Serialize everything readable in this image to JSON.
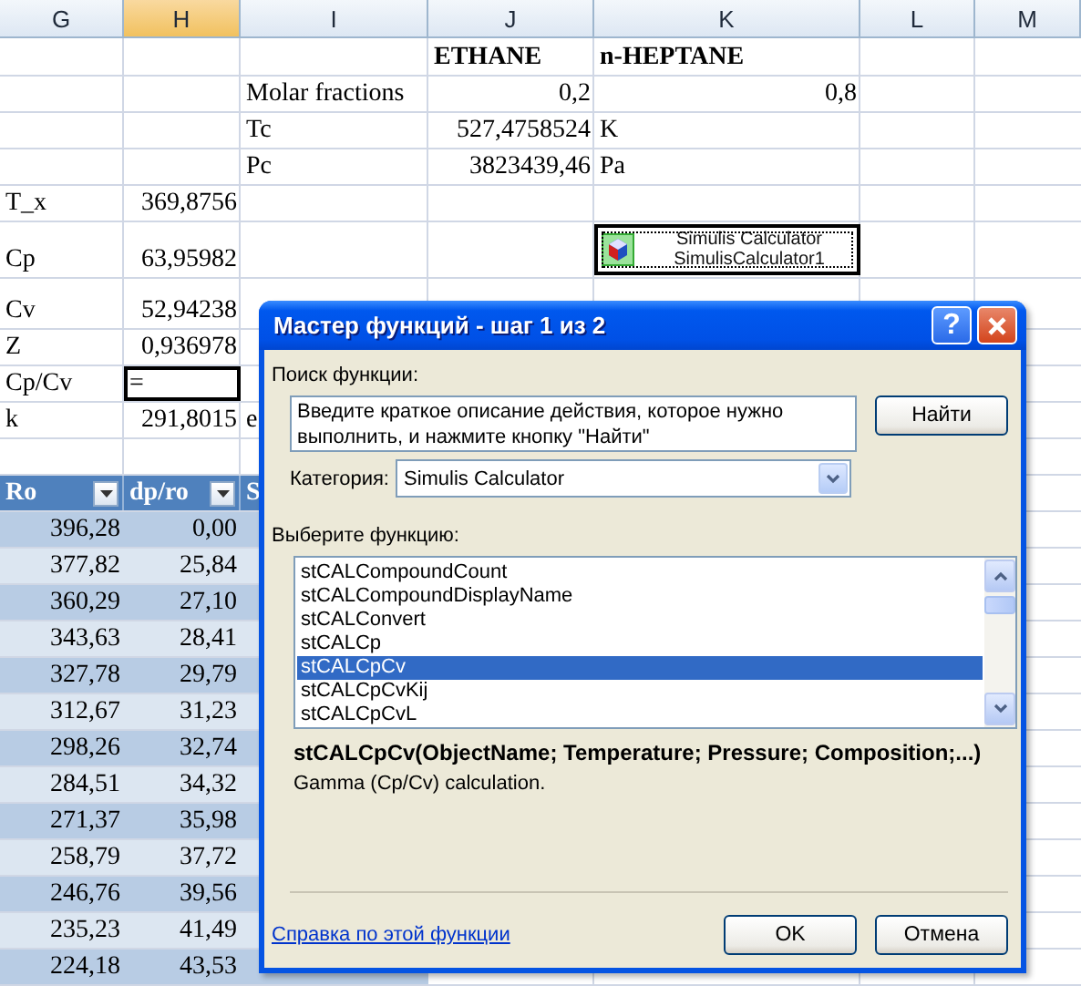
{
  "sheet": {
    "columns": [
      {
        "label": "G",
        "selected": false
      },
      {
        "label": "H",
        "selected": true
      },
      {
        "label": "I",
        "selected": false
      },
      {
        "label": "J",
        "selected": false
      },
      {
        "label": "K",
        "selected": false
      },
      {
        "label": "L",
        "selected": false
      },
      {
        "label": "M",
        "selected": false
      }
    ],
    "rows": [
      {
        "kind": "names",
        "selected": false,
        "j": "ETHANE",
        "k": "n-HEPTANE"
      },
      {
        "kind": "plain",
        "selected": false,
        "i": "Molar fractions",
        "j": "0,2",
        "k": "0,8"
      },
      {
        "kind": "plain",
        "selected": false,
        "i": "Tc",
        "j": "527,4758524",
        "unit": "K"
      },
      {
        "kind": "plain",
        "selected": false,
        "i": "Pc",
        "j": "3823439,46",
        "unit": "Pa"
      },
      {
        "kind": "plain",
        "selected": false,
        "g": "T_x",
        "h": "369,8756"
      },
      {
        "kind": "tall",
        "selected": false,
        "g": "Cp",
        "h": "63,95982"
      },
      {
        "kind": "mid",
        "selected": false,
        "g": "Cv",
        "h": "52,94238"
      },
      {
        "kind": "plain",
        "selected": false,
        "g": "Z",
        "h": "0,936978"
      },
      {
        "kind": "plain",
        "selected": true,
        "g": "Cp/Cv",
        "h": "="
      },
      {
        "kind": "plain",
        "selected": false,
        "g": "k",
        "h": "291,8015",
        "i": "e"
      },
      {
        "kind": "plain",
        "selected": false
      }
    ],
    "object": {
      "line1": "Simulis Calculator",
      "line2": "SimulisCalculator1"
    },
    "table": {
      "columns": [
        {
          "label": "Ro"
        },
        {
          "label": "dp/ro"
        },
        {
          "label": "S"
        }
      ],
      "rows": [
        [
          "396,28",
          "0,00"
        ],
        [
          "377,82",
          "25,84"
        ],
        [
          "360,29",
          "27,10"
        ],
        [
          "343,63",
          "28,41"
        ],
        [
          "327,78",
          "29,79"
        ],
        [
          "312,67",
          "31,23"
        ],
        [
          "298,26",
          "32,74"
        ],
        [
          "284,51",
          "34,32"
        ],
        [
          "271,37",
          "35,98"
        ],
        [
          "258,79",
          "37,72"
        ],
        [
          "246,76",
          "39,56"
        ],
        [
          "235,23",
          "41,49"
        ],
        [
          "224,18",
          "43,53"
        ]
      ]
    }
  },
  "dialog": {
    "title": "Мастер функций - шаг 1 из 2",
    "help_label": "?",
    "search_label": "Поиск функции:",
    "search_value": "Введите краткое описание действия, которое нужно выполнить, и нажмите кнопку \"Найти\"",
    "find_button": "Найти",
    "category_label": "Категория:",
    "category_value": "Simulis Calculator",
    "list_label": "Выберите функцию:",
    "functions": [
      {
        "name": "stCALCompoundCount",
        "selected": false
      },
      {
        "name": "stCALCompoundDisplayName",
        "selected": false
      },
      {
        "name": "stCALConvert",
        "selected": false
      },
      {
        "name": "stCALCp",
        "selected": false
      },
      {
        "name": "stCALCpCv",
        "selected": true
      },
      {
        "name": "stCALCpCvKij",
        "selected": false
      },
      {
        "name": "stCALCpCvL",
        "selected": false
      }
    ],
    "signature": "stCALCpCv(ObjectName; Temperature; Pressure; Composition;...)",
    "description": "Gamma (Cp/Cv) calculation.",
    "help_link": "Справка по этой функции",
    "buttons": [
      "OK",
      "Отмена"
    ]
  }
}
